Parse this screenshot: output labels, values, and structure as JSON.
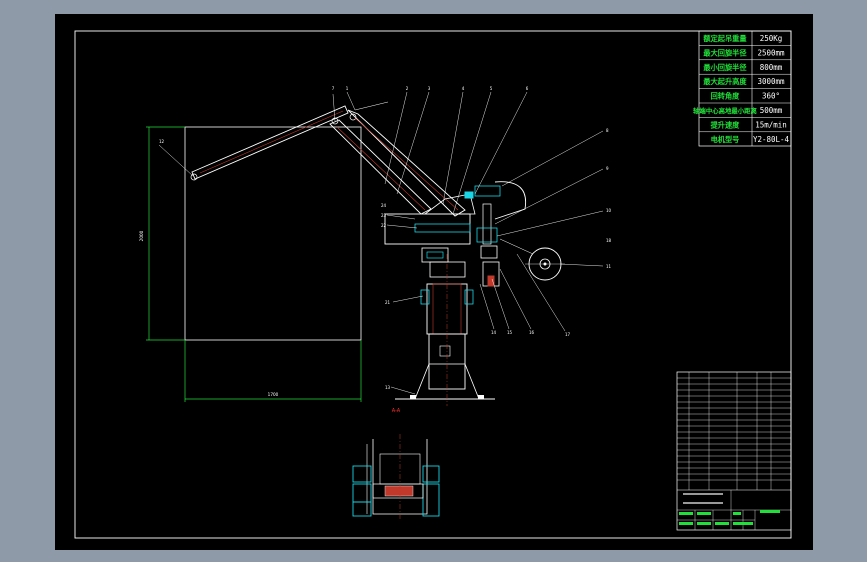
{
  "specs": [
    {
      "label": "额定起吊重量",
      "value": "250Kg"
    },
    {
      "label": "最大回旋半径",
      "value": "2500mm"
    },
    {
      "label": "最小回旋半径",
      "value": "800mm"
    },
    {
      "label": "最大起升高度",
      "value": "3000mm"
    },
    {
      "label": "回转角度",
      "value": "360°"
    },
    {
      "label": "轴端中心高地最小距离",
      "value": "500mm"
    },
    {
      "label": "提升速度",
      "value": "15m/min"
    },
    {
      "label": "电机型号",
      "value": "Y2-80L-4"
    }
  ],
  "callouts": {
    "top": [
      "1",
      "2",
      "3",
      "4",
      "5",
      "6",
      "7"
    ],
    "right": [
      "8",
      "9",
      "10",
      "11"
    ],
    "left": [
      "12",
      "13",
      "21",
      "22",
      "23",
      "24"
    ],
    "bottom": [
      "14",
      "15",
      "16",
      "17",
      "18"
    ]
  },
  "dimensions": {
    "height": "2000",
    "width": "1700",
    "section": "A-A"
  },
  "colors": {
    "background": "#000000",
    "frame": "#ffffff",
    "line": "#ffffff",
    "accent": "#22e03a",
    "cyan": "#19d6e6",
    "red": "#ff2a2a",
    "viewer": "#8f9aa8"
  }
}
